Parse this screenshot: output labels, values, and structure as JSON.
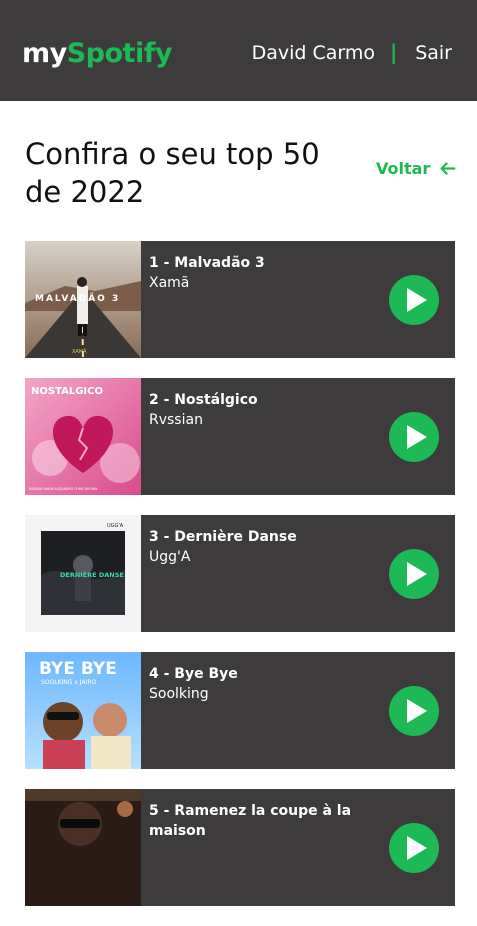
{
  "header": {
    "logo_prefix": "my",
    "logo_suffix": "Spotify",
    "user_name": "David Carmo",
    "separator": "|",
    "logout_label": "Sair"
  },
  "page": {
    "title": "Confira o seu top 50 de 2022",
    "back_label": "Voltar"
  },
  "tracks": [
    {
      "label": "1 - Malvadão 3",
      "artist": "Xamã",
      "cover_text": "MALVADÃO 3",
      "cover_subtext": "XAMÃ"
    },
    {
      "label": "2 - Nostálgico",
      "artist": "Rvssian",
      "cover_text": "NOSTALGICO",
      "cover_subtext": "RVSSIAN   RAUW ALEJANDRO   CHRIS BROWN"
    },
    {
      "label": "3 - Dernière Danse",
      "artist": "Ugg'A",
      "cover_text": "DERNIÈRE DANSE",
      "cover_subtext": "UGG'A"
    },
    {
      "label": "4 - Bye Bye",
      "artist": "Soolking",
      "cover_text": "BYE BYE",
      "cover_subtext": "SOOLKING x JAIRO"
    },
    {
      "label": "5 - Ramenez la coupe à la maison",
      "artist": "",
      "cover_text": "",
      "cover_subtext": ""
    }
  ],
  "colors": {
    "accent": "#1db954",
    "header_bg": "#3d3b3b",
    "card_bg": "#3d3b3b",
    "text_light": "#ffffff"
  }
}
